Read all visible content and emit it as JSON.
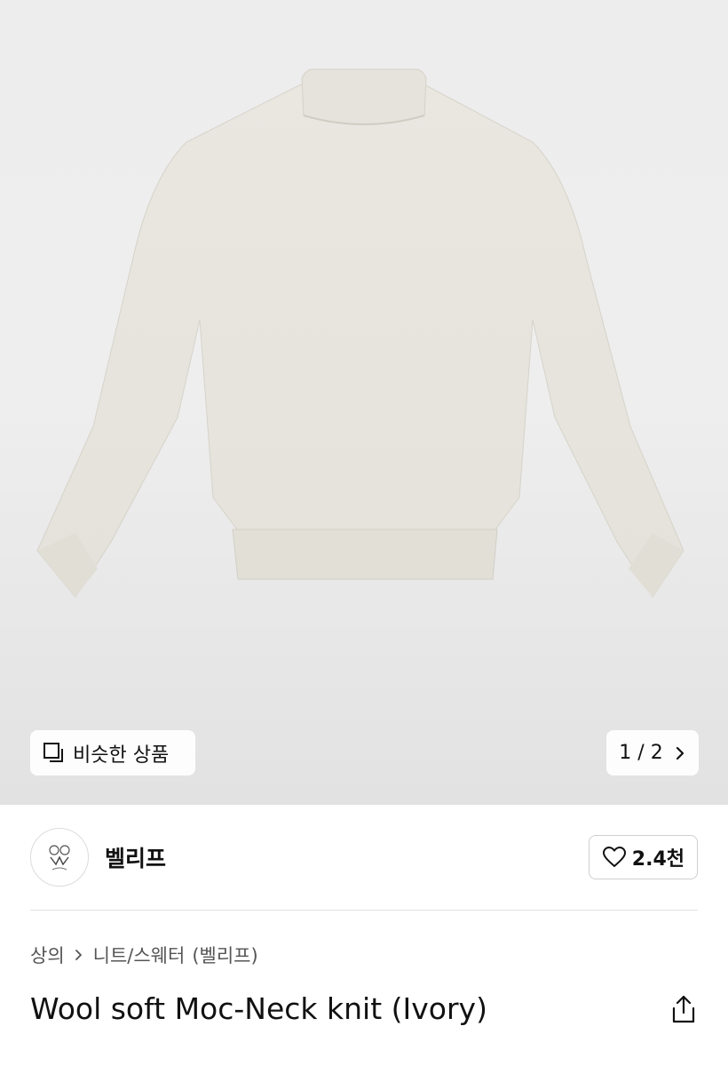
{
  "gallery": {
    "similar_label": "비슷한 상품",
    "page_indicator": "1 / 2"
  },
  "seller": {
    "name": "벨리프",
    "like_count": "2.4천"
  },
  "breadcrumb": {
    "category": "상의",
    "subcategory": "니트/스웨터",
    "brand": "(벨리프)"
  },
  "product": {
    "title": "Wool soft Moc-Neck knit (Ivory)"
  },
  "icons": {
    "similar": "copy-icon",
    "page_next": "chevron-right-icon",
    "like": "heart-icon",
    "breadcrumb_sep": "chevron-right-icon",
    "share": "share-icon"
  },
  "colors": {
    "sweater": "#e8e6de",
    "background": "#eeeeee"
  }
}
